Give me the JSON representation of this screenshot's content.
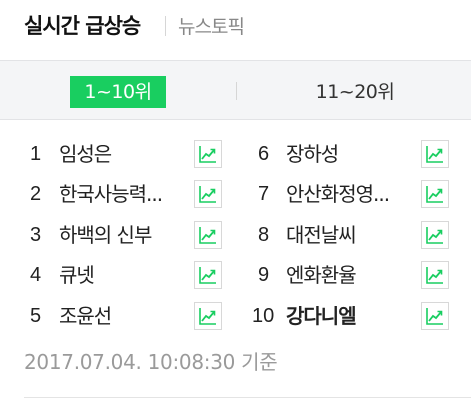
{
  "header": {
    "title": "실시간 급상승",
    "sub_tab": "뉴스토픽"
  },
  "segments": {
    "active": "1~10위",
    "inactive": "11~20위"
  },
  "left": [
    {
      "rank": "1",
      "keyword": "임성은"
    },
    {
      "rank": "2",
      "keyword": "한국사능력..."
    },
    {
      "rank": "3",
      "keyword": "하백의 신부"
    },
    {
      "rank": "4",
      "keyword": "큐넷"
    },
    {
      "rank": "5",
      "keyword": "조윤선"
    }
  ],
  "right": [
    {
      "rank": "6",
      "keyword": "장하성"
    },
    {
      "rank": "7",
      "keyword": "안산화정영..."
    },
    {
      "rank": "8",
      "keyword": "대전날씨"
    },
    {
      "rank": "9",
      "keyword": "엔화환율"
    },
    {
      "rank": "10",
      "keyword": "강다니엘"
    }
  ],
  "timestamp": "2017.07.04. 10:08:30 기준",
  "colors": {
    "accent": "#19ce60",
    "trend_icon": "#19ce60"
  },
  "icons": {
    "trend": "trend-up-chart-icon"
  }
}
